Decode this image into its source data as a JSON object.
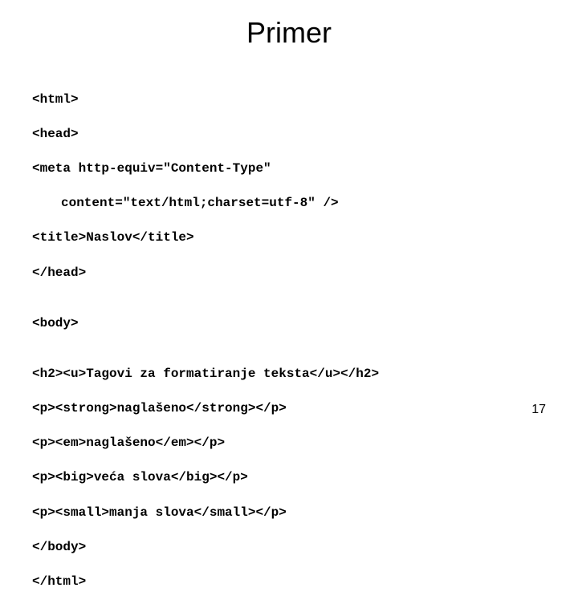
{
  "title": "Primer",
  "code": {
    "l1": "<html>",
    "l2": "<head>",
    "l3": "<meta http-equiv=\"Content-Type\"",
    "l4": "content=\"text/html;charset=utf-8\" />",
    "l5": "<title>Naslov</title>",
    "l6": "</head>",
    "l7": "<body>",
    "l8": "<h2><u>Tagovi za formatiranje teksta</u></h2>",
    "l9": "<p><strong>naglašeno</strong></p>",
    "l10": "<p><em>naglašeno</em></p>",
    "l11": "<p><big>veća slova</big></p>",
    "l12": "<p><small>manja slova</small></p>",
    "l13": "</body>",
    "l14": "</html>"
  },
  "page_number": "17"
}
